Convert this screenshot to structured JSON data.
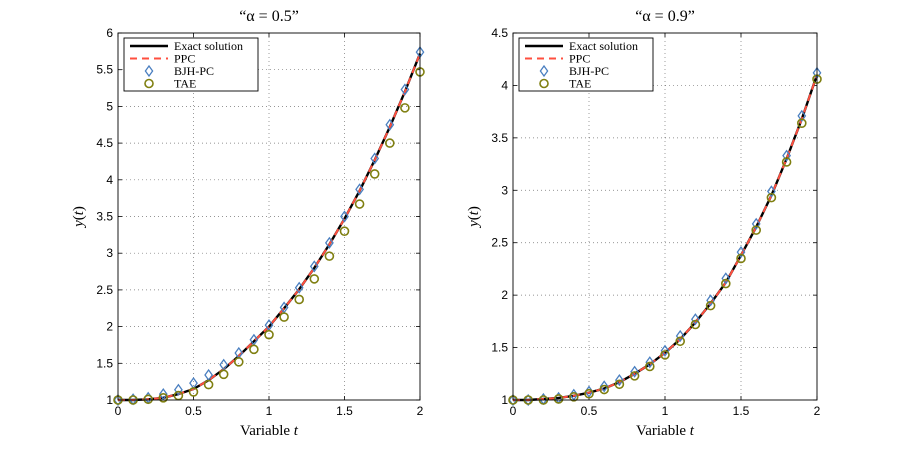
{
  "chart_data": [
    {
      "type": "line",
      "title": "“α = 0.5”",
      "xlabel": "Variable t",
      "ylabel": "y(t)",
      "xlim": [
        0,
        2
      ],
      "ylim": [
        1,
        6
      ],
      "xticks": [
        0,
        0.5,
        1,
        1.5,
        2
      ],
      "xtick_labels": [
        "0",
        "0.5",
        "1",
        "1.5",
        "2"
      ],
      "yticks": [
        1,
        1.5,
        2,
        2.5,
        3,
        3.5,
        4,
        4.5,
        5,
        5.5,
        6
      ],
      "ytick_labels": [
        "1",
        "1.5",
        "2",
        "2.5",
        "3",
        "3.5",
        "4",
        "4.5",
        "5",
        "5.5",
        "6"
      ],
      "grid": true,
      "legend_position": "top-left",
      "x": [
        0,
        0.1,
        0.2,
        0.3,
        0.4,
        0.5,
        0.6,
        0.7,
        0.8,
        0.9,
        1.0,
        1.1,
        1.2,
        1.3,
        1.4,
        1.5,
        1.6,
        1.7,
        1.8,
        1.9,
        2.0
      ],
      "series": [
        {
          "name": "Exact solution",
          "style": "line",
          "color": "#000000",
          "values": [
            1.0,
            1.0,
            1.01,
            1.03,
            1.08,
            1.15,
            1.27,
            1.42,
            1.6,
            1.8,
            2.0,
            2.25,
            2.51,
            2.8,
            3.12,
            3.47,
            3.85,
            4.27,
            4.72,
            5.2,
            5.72
          ]
        },
        {
          "name": "PPC",
          "style": "dashed",
          "color": "#ff4f3f",
          "values": [
            1.0,
            1.0,
            1.01,
            1.03,
            1.08,
            1.15,
            1.27,
            1.42,
            1.6,
            1.8,
            2.0,
            2.25,
            2.51,
            2.8,
            3.12,
            3.47,
            3.85,
            4.27,
            4.72,
            5.2,
            5.72
          ]
        },
        {
          "name": "BJH-PC",
          "style": "diamond",
          "color": "#4a7fc0",
          "values": [
            1.0,
            1.01,
            1.03,
            1.08,
            1.14,
            1.23,
            1.34,
            1.48,
            1.64,
            1.82,
            2.02,
            2.26,
            2.53,
            2.82,
            3.14,
            3.5,
            3.87,
            4.29,
            4.75,
            5.23,
            5.74
          ]
        },
        {
          "name": "TAE",
          "style": "circle",
          "color": "#7f7f10",
          "values": [
            1.0,
            1.0,
            1.01,
            1.03,
            1.06,
            1.11,
            1.21,
            1.35,
            1.52,
            1.69,
            1.89,
            2.13,
            2.37,
            2.65,
            2.96,
            3.3,
            3.67,
            4.08,
            4.5,
            4.98,
            5.47
          ]
        }
      ]
    },
    {
      "type": "line",
      "title": "“α = 0.9”",
      "xlabel": "Variable t",
      "ylabel": "y(t)",
      "xlim": [
        0,
        2
      ],
      "ylim": [
        1,
        4.5
      ],
      "xticks": [
        0,
        0.5,
        1,
        1.5,
        2
      ],
      "xtick_labels": [
        "0",
        "0.5",
        "1",
        "1.5",
        "2"
      ],
      "yticks": [
        1,
        1.5,
        2,
        2.5,
        3,
        3.5,
        4,
        4.5
      ],
      "ytick_labels": [
        "1",
        "1.5",
        "2",
        "2.5",
        "3",
        "3.5",
        "4",
        "4.5"
      ],
      "grid": true,
      "legend_position": "top-left",
      "x": [
        0,
        0.1,
        0.2,
        0.3,
        0.4,
        0.5,
        0.6,
        0.7,
        0.8,
        0.9,
        1.0,
        1.1,
        1.2,
        1.3,
        1.4,
        1.5,
        1.6,
        1.7,
        1.8,
        1.9,
        2.0
      ],
      "series": [
        {
          "name": "Exact solution",
          "style": "line",
          "color": "#000000",
          "values": [
            1.0,
            1.0,
            1.01,
            1.02,
            1.04,
            1.07,
            1.11,
            1.17,
            1.25,
            1.34,
            1.45,
            1.58,
            1.74,
            1.92,
            2.12,
            2.38,
            2.65,
            2.95,
            3.3,
            3.68,
            4.1
          ]
        },
        {
          "name": "PPC",
          "style": "dashed",
          "color": "#ff4f3f",
          "values": [
            1.0,
            1.0,
            1.01,
            1.02,
            1.04,
            1.07,
            1.11,
            1.17,
            1.25,
            1.34,
            1.45,
            1.58,
            1.74,
            1.92,
            2.12,
            2.38,
            2.65,
            2.95,
            3.3,
            3.68,
            4.1
          ]
        },
        {
          "name": "BJH-PC",
          "style": "diamond",
          "color": "#4a7fc0",
          "values": [
            1.0,
            1.0,
            1.01,
            1.02,
            1.05,
            1.08,
            1.13,
            1.19,
            1.27,
            1.36,
            1.47,
            1.61,
            1.77,
            1.95,
            2.16,
            2.41,
            2.68,
            2.99,
            3.33,
            3.71,
            4.12
          ]
        },
        {
          "name": "TAE",
          "style": "circle",
          "color": "#7f7f10",
          "values": [
            1.0,
            1.0,
            1.0,
            1.01,
            1.03,
            1.06,
            1.1,
            1.15,
            1.23,
            1.32,
            1.43,
            1.56,
            1.72,
            1.9,
            2.11,
            2.35,
            2.62,
            2.93,
            3.27,
            3.64,
            4.06
          ]
        }
      ]
    }
  ]
}
